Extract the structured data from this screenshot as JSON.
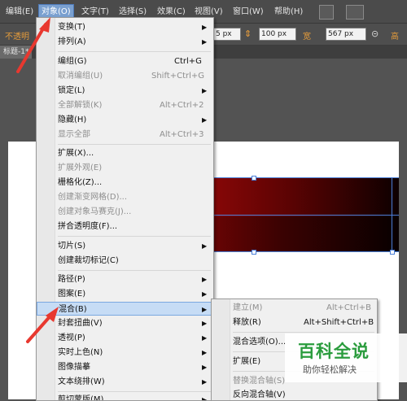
{
  "menubar": {
    "items": [
      "编辑(E)",
      "对象(O)",
      "文字(T)",
      "选择(S)",
      "效果(C)",
      "视图(V)",
      "窗口(W)",
      "帮助(H)"
    ],
    "active_index": 1
  },
  "control_bar": {
    "opacity_label": "不透明",
    "stroke_field": "5 px",
    "width_field": "100 px",
    "height_label": "宽",
    "height_field": "567 px",
    "extra_label": "高"
  },
  "document_tab": {
    "title": "标题-1*"
  },
  "object_menu": {
    "items": [
      {
        "label": "变换(T)",
        "shortcut": "",
        "submenu": true,
        "disabled": false
      },
      {
        "label": "排列(A)",
        "shortcut": "",
        "submenu": true,
        "disabled": false
      },
      {
        "label": "编组(G)",
        "shortcut": "Ctrl+G",
        "submenu": false,
        "disabled": false
      },
      {
        "label": "取消编组(U)",
        "shortcut": "Shift+Ctrl+G",
        "submenu": false,
        "disabled": true
      },
      {
        "label": "锁定(L)",
        "shortcut": "",
        "submenu": true,
        "disabled": false
      },
      {
        "label": "全部解锁(K)",
        "shortcut": "Alt+Ctrl+2",
        "submenu": false,
        "disabled": true
      },
      {
        "label": "隐藏(H)",
        "shortcut": "",
        "submenu": true,
        "disabled": false
      },
      {
        "label": "显示全部",
        "shortcut": "Alt+Ctrl+3",
        "submenu": false,
        "disabled": true
      },
      {
        "label": "扩展(X)...",
        "shortcut": "",
        "submenu": false,
        "disabled": false
      },
      {
        "label": "扩展外观(E)",
        "shortcut": "",
        "submenu": false,
        "disabled": true
      },
      {
        "label": "栅格化(Z)...",
        "shortcut": "",
        "submenu": false,
        "disabled": false
      },
      {
        "label": "创建渐变网格(D)...",
        "shortcut": "",
        "submenu": false,
        "disabled": true
      },
      {
        "label": "创建对象马赛克(J)...",
        "shortcut": "",
        "submenu": false,
        "disabled": true
      },
      {
        "label": "拼合透明度(F)...",
        "shortcut": "",
        "submenu": false,
        "disabled": false
      },
      {
        "label": "切片(S)",
        "shortcut": "",
        "submenu": true,
        "disabled": false
      },
      {
        "label": "创建裁切标记(C)",
        "shortcut": "",
        "submenu": false,
        "disabled": false
      },
      {
        "label": "路径(P)",
        "shortcut": "",
        "submenu": true,
        "disabled": false
      },
      {
        "label": "图案(E)",
        "shortcut": "",
        "submenu": true,
        "disabled": false
      },
      {
        "label": "混合(B)",
        "shortcut": "",
        "submenu": true,
        "disabled": false,
        "highlighted": true
      },
      {
        "label": "封套扭曲(V)",
        "shortcut": "",
        "submenu": true,
        "disabled": false
      },
      {
        "label": "透视(P)",
        "shortcut": "",
        "submenu": true,
        "disabled": false
      },
      {
        "label": "实时上色(N)",
        "shortcut": "",
        "submenu": true,
        "disabled": false
      },
      {
        "label": "图像描摹",
        "shortcut": "",
        "submenu": true,
        "disabled": false
      },
      {
        "label": "文本绕排(W)",
        "shortcut": "",
        "submenu": true,
        "disabled": false
      },
      {
        "label": "剪切蒙版(M)",
        "shortcut": "",
        "submenu": true,
        "disabled": false
      }
    ]
  },
  "blend_submenu": {
    "items": [
      {
        "label": "建立(M)",
        "shortcut": "Alt+Ctrl+B",
        "disabled": true
      },
      {
        "label": "释放(R)",
        "shortcut": "Alt+Shift+Ctrl+B",
        "disabled": false
      },
      {
        "label": "混合选项(O)...",
        "shortcut": "",
        "disabled": false
      },
      {
        "label": "扩展(E)",
        "shortcut": "",
        "disabled": false
      },
      {
        "label": "替换混合轴(S)",
        "shortcut": "",
        "disabled": true
      },
      {
        "label": "反向混合轴(V)",
        "shortcut": "",
        "disabled": false
      }
    ]
  },
  "watermark": {
    "title": "百科全说",
    "subtitle": "助你轻松解决"
  },
  "colors": {
    "accent": "#7aa7e0",
    "arrow": "#e8382f",
    "watermark": "#2a9c3d"
  }
}
